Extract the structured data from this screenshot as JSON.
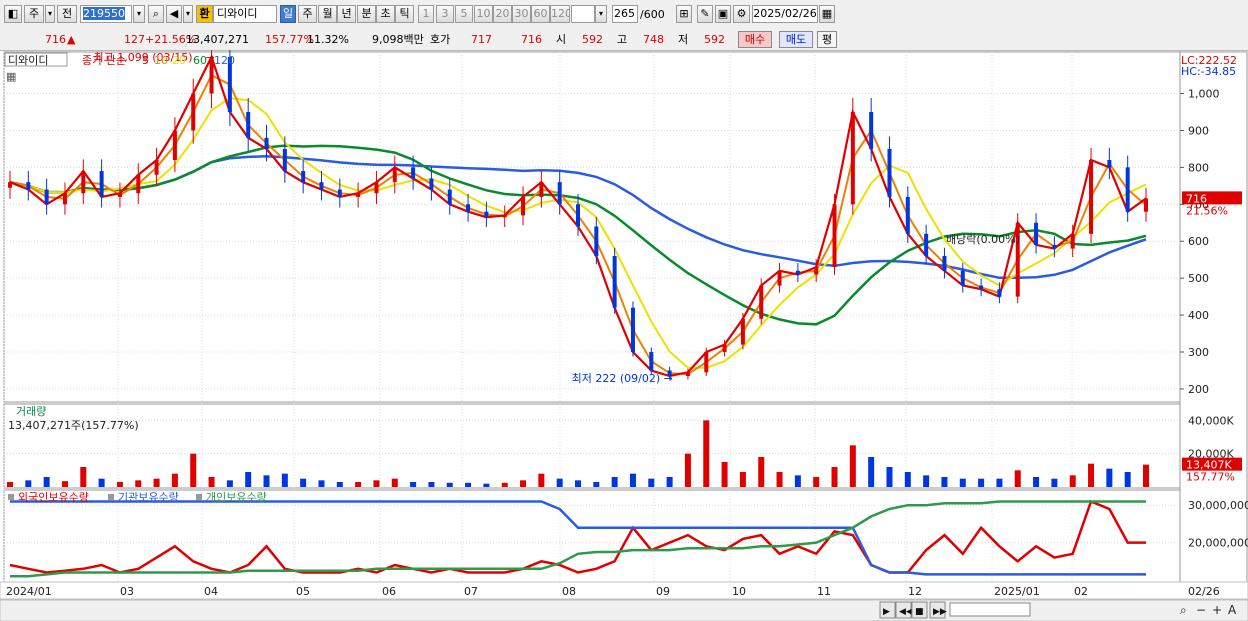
{
  "toolbar": {
    "market_label": "주",
    "prev_label": "전",
    "code": "219550",
    "flag_label": "환",
    "stock_name": "디와이디",
    "periods": [
      "일",
      "주",
      "월",
      "년",
      "분",
      "초",
      "틱"
    ],
    "selected_period": "일",
    "intervals": [
      "1",
      "3",
      "5",
      "10",
      "20",
      "30",
      "60",
      "120"
    ],
    "count": "265",
    "count_total": "/600",
    "date": "2025/02/26"
  },
  "quote": {
    "price": "716",
    "arrow": "▲",
    "change": "127",
    "change_pct": "+21.56%",
    "volume": "13,407,271",
    "volume_ratio": "157.77%",
    "turnover": "11.32%",
    "amount": "9,098백만",
    "hoga_label": "호가",
    "ask": "717",
    "bid": "716",
    "open_label": "시",
    "open": "592",
    "high_label": "고",
    "high": "748",
    "low_label": "저",
    "low": "592",
    "buy_label": "매수",
    "sell_label": "매도",
    "eval_label": "평"
  },
  "colors": {
    "up": "#e00000",
    "down": "#0036e0",
    "ma5": "#e00000",
    "ma10": "#f08000",
    "ma20": "#f0e000",
    "ma60": "#0a8a2a",
    "ma120": "#2a5be0",
    "foreign": "#e00000",
    "institution": "#2a5be0",
    "individual": "#2e9a4a"
  },
  "chart_data": [
    {
      "type": "candlestick",
      "name": "디와이디",
      "legend": [
        "종가 단순",
        "5",
        "10",
        "20",
        "60",
        "120"
      ],
      "lc_label": "LC:222.52",
      "hc_label": "HC:-34.85",
      "ylim": [
        170,
        1080
      ],
      "y_ticks": [
        200,
        300,
        400,
        500,
        600,
        700,
        800,
        900,
        1000
      ],
      "x_labels": [
        "2024/01",
        "03",
        "04",
        "05",
        "06",
        "07",
        "08",
        "09",
        "10",
        "11",
        "12",
        "2025/01",
        "02",
        "02/26"
      ],
      "annotations": {
        "high": "최고 1,099 (03/15)",
        "low": "최저 222 (09/02)",
        "dividend": "배당락(0.00%)",
        "last_price": "716",
        "last_pct": "21.56%"
      },
      "series": [
        {
          "name": "종가",
          "x": [
            "01/02",
            "01/09",
            "01/16",
            "01/23",
            "01/30",
            "02/06",
            "02/13",
            "02/20",
            "02/27",
            "03/05",
            "03/12",
            "03/15",
            "03/19",
            "03/26",
            "04/02",
            "04/09",
            "04/16",
            "04/23",
            "04/30",
            "05/07",
            "05/14",
            "05/21",
            "05/28",
            "06/04",
            "06/11",
            "06/18",
            "06/25",
            "07/02",
            "07/09",
            "07/16",
            "07/23",
            "07/30",
            "08/06",
            "08/13",
            "08/20",
            "08/27",
            "09/02",
            "09/09",
            "09/16",
            "09/23",
            "09/30",
            "10/07",
            "10/14",
            "10/21",
            "10/28",
            "11/04",
            "11/11",
            "11/18",
            "11/25",
            "12/02",
            "12/09",
            "12/16",
            "12/23",
            "12/30",
            "01/06",
            "01/13",
            "01/20",
            "01/27",
            "02/03",
            "02/10",
            "02/17",
            "02/21",
            "02/26"
          ],
          "values": [
            760,
            740,
            700,
            730,
            790,
            720,
            730,
            780,
            820,
            900,
            1000,
            1099,
            950,
            880,
            850,
            790,
            760,
            740,
            720,
            730,
            760,
            800,
            770,
            740,
            700,
            680,
            665,
            670,
            720,
            760,
            700,
            640,
            560,
            420,
            300,
            250,
            235,
            245,
            300,
            320,
            390,
            480,
            520,
            510,
            530,
            700,
            950,
            850,
            720,
            620,
            560,
            520,
            480,
            470,
            450,
            650,
            590,
            580,
            620,
            820,
            800,
            680,
            716
          ]
        },
        {
          "name": "MA5",
          "note": "moving average"
        },
        {
          "name": "MA10"
        },
        {
          "name": "MA20"
        },
        {
          "name": "MA60"
        },
        {
          "name": "MA120"
        }
      ]
    },
    {
      "type": "bar",
      "name": "거래량",
      "summary": "13,407,271주(157.77%)",
      "y_ticks": [
        "20,000K",
        "40,000K"
      ],
      "ylim": [
        0,
        45000
      ],
      "last_value": "13,407K",
      "last_pct": "157.77%",
      "values_k": [
        3000,
        4000,
        6000,
        3500,
        12000,
        5000,
        3000,
        4000,
        5000,
        8000,
        20000,
        6000,
        4000,
        9000,
        7000,
        8000,
        5000,
        4000,
        3000,
        3000,
        4000,
        5000,
        3000,
        3000,
        2500,
        2500,
        2000,
        2500,
        4000,
        8000,
        5000,
        4000,
        3000,
        6000,
        8000,
        5000,
        6000,
        20000,
        40000,
        15000,
        9000,
        18000,
        9000,
        7000,
        6000,
        12000,
        25000,
        18000,
        12000,
        9000,
        7000,
        6000,
        5000,
        5000,
        5000,
        10000,
        6000,
        5000,
        7000,
        14000,
        11000,
        9000,
        13407
      ]
    },
    {
      "type": "line",
      "name": "투자자별 보유수량",
      "legend": [
        "외국인보유수량",
        "기관보유수량",
        "개인보유수량"
      ],
      "y_ticks": [
        "20,000,000",
        "30,000,000"
      ],
      "ylim": [
        10000000,
        33000000
      ],
      "series": [
        {
          "name": "외국인보유수량",
          "values": [
            14000000,
            13000000,
            12000000,
            12500000,
            13000000,
            14000000,
            12000000,
            13000000,
            16000000,
            19000000,
            15000000,
            13000000,
            12000000,
            14000000,
            19000000,
            13000000,
            12000000,
            12000000,
            12000000,
            13000000,
            12000000,
            14000000,
            13000000,
            12000000,
            13000000,
            12000000,
            12000000,
            12000000,
            13000000,
            15000000,
            14000000,
            12000000,
            13000000,
            15000000,
            24000000,
            18000000,
            20000000,
            22000000,
            19000000,
            18000000,
            21000000,
            22000000,
            17000000,
            19000000,
            17000000,
            23000000,
            22000000,
            14000000,
            12000000,
            12000000,
            18000000,
            22000000,
            17000000,
            24000000,
            19000000,
            15000000,
            19000000,
            16000000,
            17000000,
            31000000,
            29000000,
            20000000,
            20000000
          ]
        },
        {
          "name": "기관보유수량",
          "values": [
            31000000,
            31000000,
            31000000,
            31000000,
            31000000,
            31000000,
            31000000,
            31000000,
            31000000,
            31000000,
            31000000,
            31000000,
            31000000,
            31000000,
            31000000,
            31000000,
            31000000,
            31000000,
            31000000,
            31000000,
            31000000,
            31000000,
            31000000,
            31000000,
            31000000,
            31000000,
            31000000,
            31000000,
            31000000,
            31000000,
            29000000,
            24000000,
            24000000,
            24000000,
            24000000,
            24000000,
            24000000,
            24000000,
            24000000,
            24000000,
            24000000,
            24000000,
            24000000,
            24000000,
            24000000,
            24000000,
            24000000,
            14000000,
            12000000,
            12000000,
            11500000,
            11500000,
            11500000,
            11500000,
            11500000,
            11500000,
            11500000,
            11500000,
            11500000,
            11500000,
            11500000,
            11500000,
            11500000
          ]
        },
        {
          "name": "개인보유수량",
          "values": [
            11000000,
            11000000,
            11500000,
            12000000,
            12000000,
            12000000,
            12000000,
            12000000,
            12000000,
            12000000,
            12000000,
            12000000,
            12000000,
            12500000,
            12500000,
            12500000,
            12500000,
            12500000,
            12500000,
            12500000,
            13000000,
            13000000,
            13000000,
            13000000,
            13000000,
            13000000,
            13000000,
            13000000,
            13000000,
            13000000,
            14500000,
            17000000,
            17500000,
            17500000,
            18000000,
            18000000,
            18000000,
            18500000,
            18500000,
            18500000,
            18500000,
            19000000,
            19000000,
            19500000,
            20000000,
            22000000,
            24000000,
            27000000,
            29000000,
            30000000,
            30000000,
            30500000,
            30500000,
            30500000,
            31000000,
            31000000,
            31000000,
            31000000,
            31000000,
            31000000,
            31000000,
            31000000,
            31000000
          ]
        }
      ]
    }
  ],
  "scroll": {
    "nav_buttons": [
      "▶",
      "◀◀",
      "■",
      "▶▶"
    ]
  }
}
